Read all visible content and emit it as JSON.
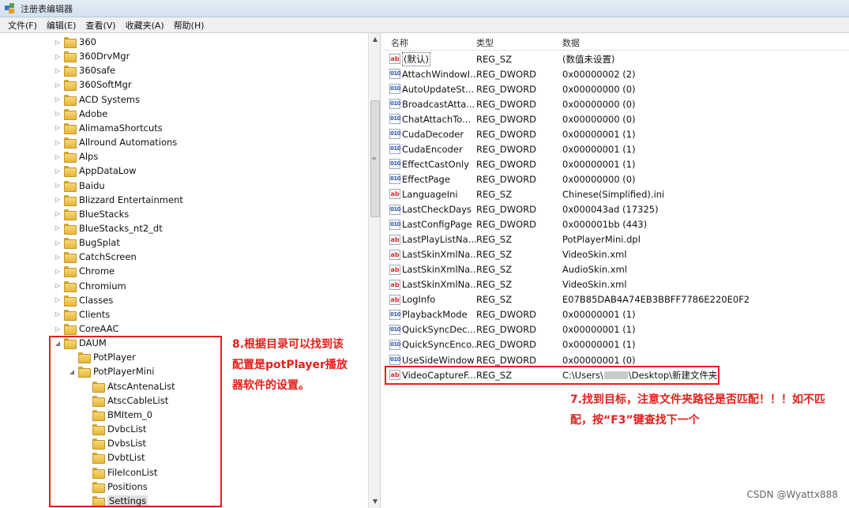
{
  "window": {
    "title": "注册表编辑器"
  },
  "menu": [
    "文件(F)",
    "编辑(E)",
    "查看(V)",
    "收藏夹(A)",
    "帮助(H)"
  ],
  "tree": {
    "top_items": [
      "360",
      "360DrvMgr",
      "360safe",
      "360SoftMgr",
      "ACD Systems",
      "Adobe",
      "AlimamaShortcuts",
      "Allround Automations",
      "Alps",
      "AppDataLow",
      "Baidu",
      "Blizzard Entertainment",
      "BlueStacks",
      "BlueStacks_nt2_dt",
      "BugSplat",
      "CatchScreen",
      "Chrome",
      "Chromium",
      "Classes",
      "Clients",
      "CoreAAC"
    ],
    "daum": "DAUM",
    "potplayer": "PotPlayer",
    "potplayermini": "PotPlayerMini",
    "sub_items": [
      "AtscAntenaList",
      "AtscCableList",
      "BMItem_0",
      "DvbcList",
      "DvbsList",
      "DvbtList",
      "FileIconList",
      "Positions",
      "Settings"
    ]
  },
  "list": {
    "headers": {
      "name": "名称",
      "type": "类型",
      "data": "数据"
    },
    "rows": [
      {
        "icon": "ab",
        "name": "(默认)",
        "type": "REG_SZ",
        "data": "(数值未设置)"
      },
      {
        "icon": "dw",
        "name": "AttachWindowI...",
        "type": "REG_DWORD",
        "data": "0x00000002 (2)"
      },
      {
        "icon": "dw",
        "name": "AutoUpdateSt...",
        "type": "REG_DWORD",
        "data": "0x00000000 (0)"
      },
      {
        "icon": "dw",
        "name": "BroadcastAtta...",
        "type": "REG_DWORD",
        "data": "0x00000000 (0)"
      },
      {
        "icon": "dw",
        "name": "ChatAttachTo...",
        "type": "REG_DWORD",
        "data": "0x00000000 (0)"
      },
      {
        "icon": "dw",
        "name": "CudaDecoder",
        "type": "REG_DWORD",
        "data": "0x00000001 (1)"
      },
      {
        "icon": "dw",
        "name": "CudaEncoder",
        "type": "REG_DWORD",
        "data": "0x00000001 (1)"
      },
      {
        "icon": "dw",
        "name": "EffectCastOnly",
        "type": "REG_DWORD",
        "data": "0x00000001 (1)"
      },
      {
        "icon": "dw",
        "name": "EffectPage",
        "type": "REG_DWORD",
        "data": "0x00000000 (0)"
      },
      {
        "icon": "ab",
        "name": "LanguageIni",
        "type": "REG_SZ",
        "data": "Chinese(Simplified).ini"
      },
      {
        "icon": "dw",
        "name": "LastCheckDays",
        "type": "REG_DWORD",
        "data": "0x000043ad (17325)"
      },
      {
        "icon": "dw",
        "name": "LastConfigPage",
        "type": "REG_DWORD",
        "data": "0x000001bb (443)"
      },
      {
        "icon": "ab",
        "name": "LastPlayListNa...",
        "type": "REG_SZ",
        "data": "PotPlayerMini.dpl"
      },
      {
        "icon": "ab",
        "name": "LastSkinXmlNa...",
        "type": "REG_SZ",
        "data": "VideoSkin.xml"
      },
      {
        "icon": "ab",
        "name": "LastSkinXmlNa...",
        "type": "REG_SZ",
        "data": "AudioSkin.xml"
      },
      {
        "icon": "ab",
        "name": "LastSkinXmlNa...",
        "type": "REG_SZ",
        "data": "VideoSkin.xml"
      },
      {
        "icon": "ab",
        "name": "LogInfo",
        "type": "REG_SZ",
        "data": "E07B85DAB4A74EB3BBFF7786E220E0F2"
      },
      {
        "icon": "dw",
        "name": "PlaybackMode",
        "type": "REG_DWORD",
        "data": "0x00000001 (1)"
      },
      {
        "icon": "dw",
        "name": "QuickSyncDec...",
        "type": "REG_DWORD",
        "data": "0x00000001 (1)"
      },
      {
        "icon": "dw",
        "name": "QuickSyncEnco...",
        "type": "REG_DWORD",
        "data": "0x00000001 (1)"
      },
      {
        "icon": "dw",
        "name": "UseSideWindow",
        "type": "REG_DWORD",
        "data": "0x00000001 (0)"
      },
      {
        "icon": "ab",
        "name": "VideoCaptureF...",
        "type": "REG_SZ",
        "data_prefix": "C:\\Users\\",
        "data_suffix": "\\Desktop\\新建文件夹"
      }
    ]
  },
  "annotations": {
    "left": [
      "8.根据目录可以找到该",
      "配置是potPlayer播放",
      "器软件的设置。"
    ],
    "right": [
      "7.找到目标，注意文件夹路径是否匹配！！！如不匹",
      "配，按“F3”键查找下一个"
    ]
  },
  "colors": {
    "annotation": "#e3201b"
  },
  "icons": {
    "app": "registry-editor-icon",
    "folder": "folder-icon",
    "string": "reg-sz-icon",
    "dword": "reg-dword-icon"
  },
  "watermark": "CSDN @Wyattx888"
}
